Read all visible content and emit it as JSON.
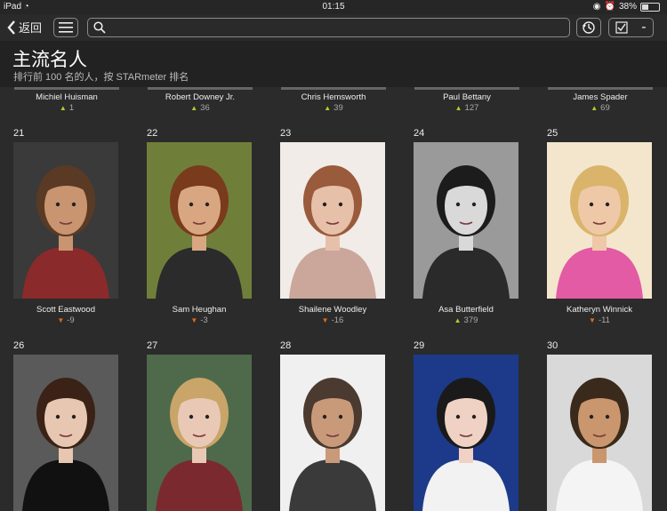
{
  "status": {
    "device": "iPad",
    "time": "01:15",
    "battery": "38%",
    "battery_level": 0.38
  },
  "toolbar": {
    "back_label": "返回",
    "search_placeholder": "",
    "watchlist_label": "-"
  },
  "header": {
    "title": "主流名人",
    "subtitle": "排行前 100 名的人，按 STARmeter 排名"
  },
  "previous_row": [
    {
      "name": "Michiel Huisman",
      "change": "1",
      "trend": "up"
    },
    {
      "name": "Robert Downey Jr.",
      "change": "36",
      "trend": "up"
    },
    {
      "name": "Chris Hemsworth",
      "change": "39",
      "trend": "up"
    },
    {
      "name": "Paul Bettany",
      "change": "127",
      "trend": "up"
    },
    {
      "name": "James Spader",
      "change": "69",
      "trend": "up"
    }
  ],
  "celebrities": [
    {
      "rank": "21",
      "name": "Scott Eastwood",
      "change": "-9",
      "trend": "down",
      "bg": "#3a3a3a",
      "skin": "#c99470",
      "hair": "#5a3a24",
      "shirt": "#8b2a2a"
    },
    {
      "rank": "22",
      "name": "Sam Heughan",
      "change": "-3",
      "trend": "down",
      "bg": "#6f7f3a",
      "skin": "#d8a782",
      "hair": "#7a3a1c",
      "shirt": "#2b2b2b"
    },
    {
      "rank": "23",
      "name": "Shailene Woodley",
      "change": "-16",
      "trend": "down",
      "bg": "#f1ece8",
      "skin": "#e7c0aa",
      "hair": "#9a5a3c",
      "shirt": "#caa79a"
    },
    {
      "rank": "24",
      "name": "Asa Butterfield",
      "change": "379",
      "trend": "up",
      "bg": "#9a9a9a",
      "skin": "#d9d9d9",
      "hair": "#1c1c1c",
      "shirt": "#2a2a2a"
    },
    {
      "rank": "25",
      "name": "Katheryn Winnick",
      "change": "-11",
      "trend": "down",
      "bg": "#f3e6cc",
      "skin": "#efc8a8",
      "hair": "#d9b46a",
      "shirt": "#e35aa5"
    },
    {
      "rank": "26",
      "name": "",
      "change": "",
      "trend": "",
      "bg": "#5a5a5a",
      "skin": "#e8c7b2",
      "hair": "#3a2216",
      "shirt": "#111111"
    },
    {
      "rank": "27",
      "name": "",
      "change": "",
      "trend": "",
      "bg": "#4f6a4a",
      "skin": "#e9c9b6",
      "hair": "#c9a56a",
      "shirt": "#7a2a2f"
    },
    {
      "rank": "28",
      "name": "",
      "change": "",
      "trend": "",
      "bg": "#f0f0f0",
      "skin": "#c99a7a",
      "hair": "#4a3a30",
      "shirt": "#3a3a3a"
    },
    {
      "rank": "29",
      "name": "",
      "change": "",
      "trend": "",
      "bg": "#1d3a8a",
      "skin": "#f0d2c4",
      "hair": "#1a1a1a",
      "shirt": "#f2f2f2"
    },
    {
      "rank": "30",
      "name": "",
      "change": "",
      "trend": "",
      "bg": "#d9d9d9",
      "skin": "#c9966e",
      "hair": "#3a2a1c",
      "shirt": "#f4f4f4"
    }
  ],
  "icons": {
    "back": "chevron-left-icon",
    "menu": "hamburger-menu-icon",
    "search": "search-icon",
    "history": "history-icon",
    "watchlist": "watchlist-check-icon"
  }
}
